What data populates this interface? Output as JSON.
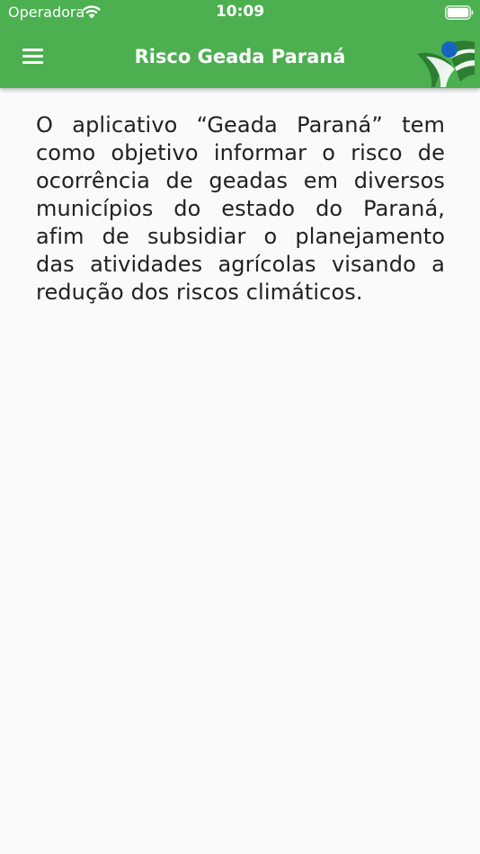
{
  "status_bar": {
    "carrier": "Operadora",
    "time": "10:09",
    "icons": [
      "wifi-icon",
      "battery-icon"
    ]
  },
  "app_bar": {
    "title": "Risco Geada Paraná",
    "menu_icon": "hamburger-menu-icon",
    "logo_icon": "geada-parana-logo-icon",
    "background_color": "#4caf50",
    "text_color": "#ffffff"
  },
  "content": {
    "description": "O aplicativo “Geada Paraná” tem como objetivo informar o risco de ocorrência de geadas em diversos municípios do estado do Paraná, afim de subsidiar o planejamento das atividades agrícolas visando a redução dos riscos climáticos."
  },
  "colors": {
    "page_background": "#fafafa",
    "body_text": "#212121",
    "logo_blue": "#1565c0",
    "logo_green": "#2e7d32"
  }
}
